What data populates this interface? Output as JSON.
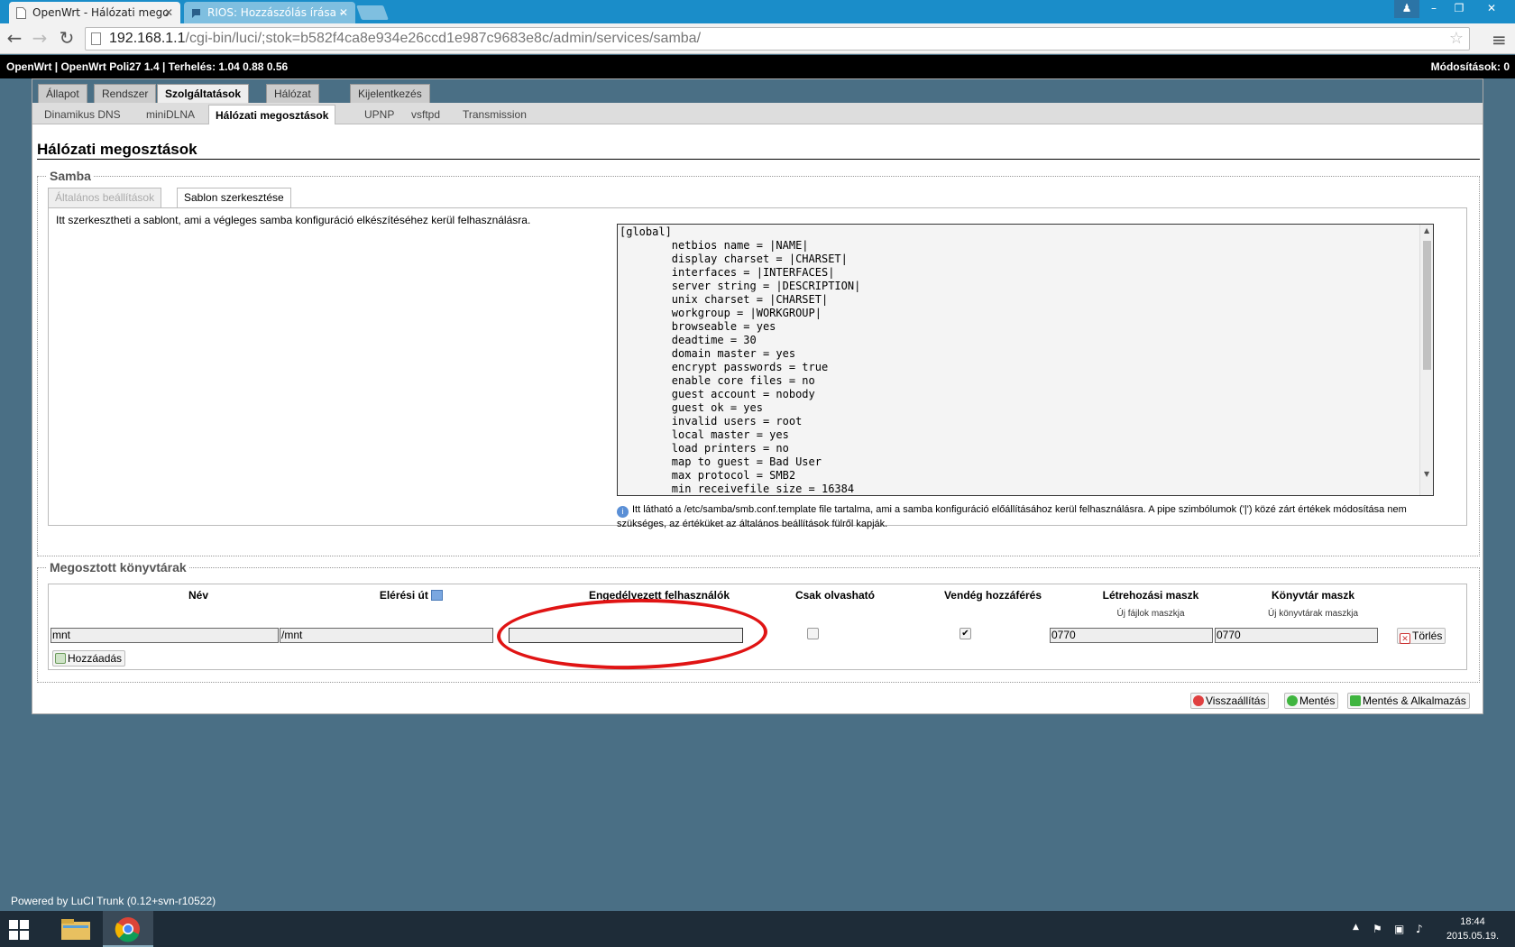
{
  "browser": {
    "tabs": [
      {
        "label": "OpenWrt - Hálózati mego"
      },
      {
        "label": "RIOS: Hozzászólás írása -"
      }
    ],
    "url_host": "192.168.1.1",
    "url_path": "/cgi-bin/luci/;stok=b582f4ca8e934e26ccd1e987c9683e8c/admin/services/samba/"
  },
  "header": {
    "left": "OpenWrt | OpenWrt Poli27 1.4 | Terhelés: 1.04 0.88 0.56",
    "changes": "Módosítások: 0"
  },
  "main_tabs": [
    "Állapot",
    "Rendszer",
    "Szolgáltatások",
    "Hálózat",
    "Kijelentkezés"
  ],
  "sub_tabs": [
    "Dinamikus DNS",
    "miniDLNA",
    "Hálózati megosztások",
    "UPNP",
    "vsftpd",
    "Transmission"
  ],
  "page_title": "Hálózati megosztások",
  "samba": {
    "legend": "Samba",
    "tab_general": "Általános beállítások",
    "tab_template": "Sablon szerkesztése",
    "description": "Itt szerkesztheti a sablont, ami a végleges samba konfiguráció elkészítéséhez kerül felhasználásra.",
    "template_text": "[global]\n\tnetbios name = |NAME|\n\tdisplay charset = |CHARSET|\n\tinterfaces = |INTERFACES|\n\tserver string = |DESCRIPTION|\n\tunix charset = |CHARSET|\n\tworkgroup = |WORKGROUP|\n\tbrowseable = yes\n\tdeadtime = 30\n\tdomain master = yes\n\tencrypt passwords = true\n\tenable core files = no\n\tguest account = nobody\n\tguest ok = yes\n\tinvalid users = root\n\tlocal master = yes\n\tload printers = no\n\tmap to guest = Bad User\n\tmax protocol = SMB2\n\tmin receivefile size = 16384",
    "hint": "Itt látható a /etc/samba/smb.conf.template file tartalma, ami a samba konfiguráció előállításához kerül felhasználásra. A pipe szimbólumok ('|') közé zárt értékek módosítása nem szükséges, az értéküket az általános beállítások fülről kapják."
  },
  "shares": {
    "legend": "Megosztott könyvtárak",
    "columns": {
      "name": "Név",
      "path": "Elérési út",
      "users": "Engedélyezett felhasználók",
      "readonly": "Csak olvasható",
      "guest": "Vendég hozzáférés",
      "create_mask": "Létrehozási maszk",
      "dir_mask": "Könyvtár maszk"
    },
    "subheaders": {
      "create_mask": "Új fájlok maszkja",
      "dir_mask": "Új könyvtárak maszkja"
    },
    "row": {
      "name": "mnt",
      "path": "/mnt",
      "users": "",
      "readonly": false,
      "guest": true,
      "create_mask": "0770",
      "dir_mask": "0770"
    },
    "delete_label": "Törlés",
    "add_label": "Hozzáadás"
  },
  "actions": {
    "reset": "Visszaállítás",
    "save": "Mentés",
    "save_apply": "Mentés & Alkalmazás"
  },
  "footer": "Powered by LuCI Trunk (0.12+svn-r10522)",
  "taskbar": {
    "time": "18:44",
    "date": "2015.05.19."
  },
  "colors": {
    "tabstrip": "#1a8dc9",
    "page_bg": "#4a6f85",
    "annotation": "#e01414"
  }
}
